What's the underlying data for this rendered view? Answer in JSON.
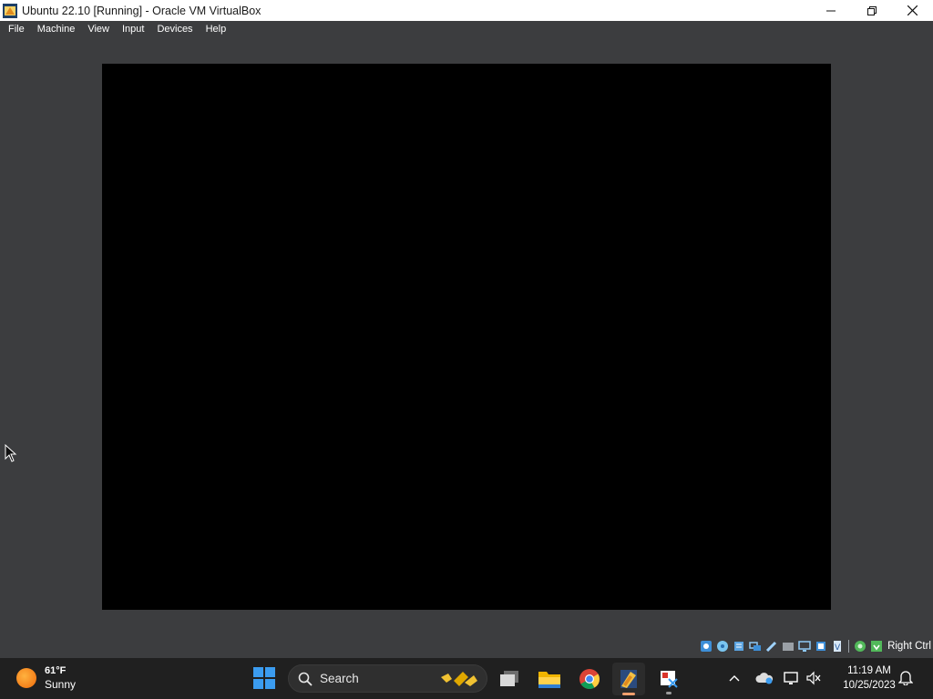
{
  "window": {
    "title": "Ubuntu 22.10 [Running] - Oracle VM VirtualBox",
    "app_icon": "virtualbox-icon",
    "controls": [
      "minimize-icon",
      "maximize-icon",
      "close-icon"
    ]
  },
  "menubar": {
    "items": [
      "File",
      "Machine",
      "View",
      "Input",
      "Devices",
      "Help"
    ]
  },
  "vm_display": {
    "state": "black screen"
  },
  "statusbar": {
    "icons": [
      "hard-disk-icon",
      "optical-drive-icon",
      "audio-icon",
      "network-icon",
      "usb-icon",
      "shared-folders-icon",
      "display-icon",
      "recording-icon",
      "cpu-icon",
      "mouse-integration-icon",
      "keyboard-capture-icon"
    ],
    "host_key": "Right Ctrl"
  },
  "taskbar": {
    "weather": {
      "temp": "61°F",
      "condition": "Sunny"
    },
    "search": {
      "placeholder": "Search"
    },
    "apps": [
      "start-icon",
      "task-view-icon",
      "file-explorer-icon",
      "chrome-icon",
      "virtualbox-icon",
      "snipping-tool-icon"
    ],
    "active_app": "virtualbox-icon",
    "tray": [
      "chevron-up-icon",
      "onedrive-icon",
      "network-icon",
      "volume-muted-icon"
    ],
    "clock": {
      "time": "11:19 AM",
      "date": "10/25/2023"
    },
    "colors": {
      "taskbar_bg": "#202020",
      "active_indicator": "#f3a06d",
      "start_blue": "#3b9cf0"
    }
  }
}
